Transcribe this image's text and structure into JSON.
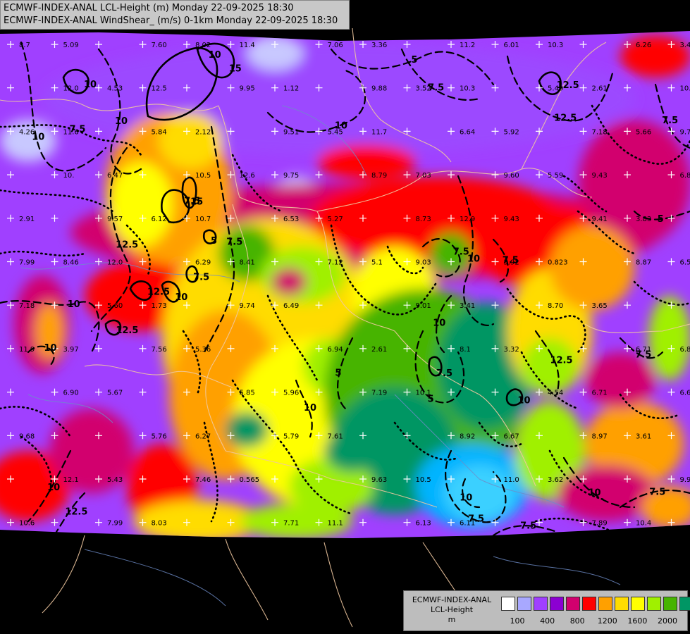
{
  "header": {
    "line1": "ECMWF-INDEX-ANAL LCL-Height (m) Monday 22-09-2025 18:30",
    "line2": "ECMWF-INDEX-ANAL WindShear_ (m/s) 0-1km Monday 22-09-2025 18:30"
  },
  "legend": {
    "title_line1": "ECMWF-INDEX-ANAL",
    "title_line2": "LCL-Height",
    "title_line3": "m",
    "colors": [
      "#ffffff",
      "#a8a8ff",
      "#a040ff",
      "#8c00d2",
      "#d2006e",
      "#ff0000",
      "#ffa000",
      "#ffdc00",
      "#ffff00",
      "#a0f000",
      "#46b400",
      "#009664",
      "#00b4ff"
    ],
    "ticks": [
      "100",
      "400",
      "800",
      "1200",
      "1600",
      "2000"
    ]
  },
  "map_labels": {
    "station_values": [
      "7.60",
      "11.2",
      "12.0",
      "9.88",
      "10.6",
      "9.51",
      "7.18",
      "10.5",
      "9.60",
      "9.57",
      "8.73",
      "7.99",
      "7.12",
      "8.87",
      "9.74",
      "8.70",
      "7.56",
      "8.1",
      "6.90",
      "7.19",
      "6.69",
      "5.79",
      "8.97",
      "7.46",
      "11.0",
      "7.99",
      "6.13",
      "8.7",
      "7.06",
      "6.26",
      "9.95",
      "5.49",
      "5.84",
      "6.64",
      "10.",
      "8.79",
      "6.88",
      "6.53",
      "9.41",
      "6.29",
      "5.92",
      "5.60",
      "9.01",
      "11.9",
      "6.94",
      "6.71",
      "5.85",
      "4.54",
      "5.76",
      "8.92",
      "12.1",
      "9.63",
      "9.94",
      "7.71",
      "7.89",
      "8.02",
      "6.01",
      "4.53",
      "3.52",
      "4.26",
      "5.45",
      "5.66",
      "12.6",
      "5.59",
      "6.12",
      "12.9",
      "8.46",
      "5.1",
      "6.54",
      "6.49",
      "3.65",
      "5.36",
      "3.32",
      "5.67",
      "10.1",
      "9.68",
      "7.61",
      "3.61",
      "0.565",
      "3.62",
      "8.03",
      "6.11",
      "5.09",
      "3.36",
      "3.41",
      "1.12",
      "2.61",
      "2.12",
      "5.92",
      "6.47",
      "7.03",
      "2.91",
      "5.27",
      "3.83",
      "8.41",
      "0.823",
      "1.73",
      "3.41",
      "3.97",
      "2.61",
      "6.85",
      "5.96",
      "6.71",
      "6.27",
      "6.67",
      "5.43",
      "10.5",
      "10.6",
      "11.1",
      "10.4",
      "11.4",
      "10.3",
      "12.5",
      "10.3",
      "11.6",
      "11.7",
      "9.76",
      "9.75",
      "9.43",
      "10.7",
      "9.43",
      "12.0",
      "9.03",
      "7.18"
    ],
    "contour_labels": [
      "10",
      "15",
      "10",
      "12.5",
      "7.5",
      "12.5",
      "10",
      "12.5",
      "7.5",
      "10",
      "7.5",
      "5",
      "15",
      "10",
      "10",
      "12.5",
      "7.5",
      "10",
      "10",
      "5",
      "7.5",
      "12.5",
      "7.5",
      "10",
      "7.5",
      "10",
      "7.5",
      "5",
      "10",
      "7.5",
      "10",
      "7.5",
      "12.5",
      "10",
      "12.5",
      "10",
      "7.5",
      "5",
      "7.5",
      "5",
      "10",
      "7.5"
    ]
  }
}
